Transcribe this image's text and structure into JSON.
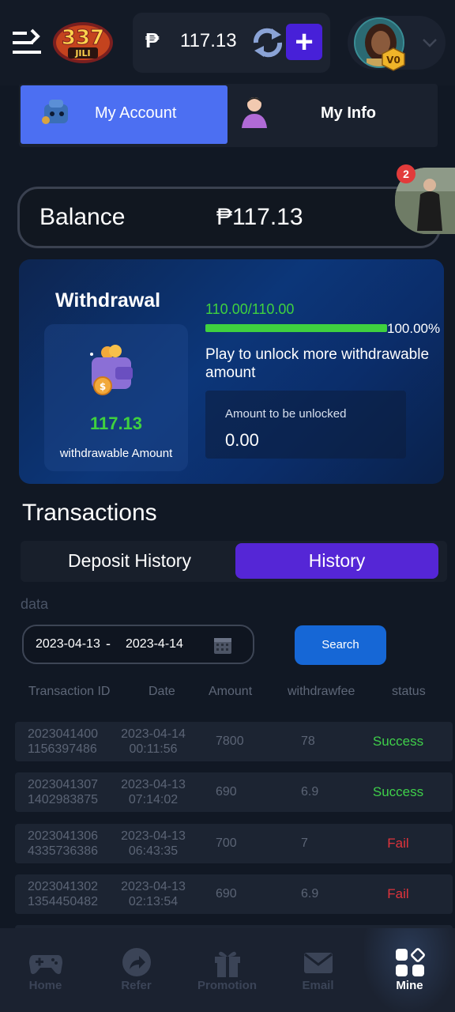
{
  "header": {
    "currency_symbol": "₱",
    "wallet_amount": "117.13",
    "plus_label": "+",
    "vip_label": "V0"
  },
  "account_tabs": {
    "my_account": "My Account",
    "my_info": "My Info"
  },
  "balance": {
    "label": "Balance",
    "value": "₱117.13",
    "notification_count": "2"
  },
  "withdrawal": {
    "title": "Withdrawal",
    "amount": "117.13",
    "amount_caption": "withdrawable Amount",
    "progress_text": "110.00/110.00",
    "progress_percent": "100.00%",
    "progress_fraction": 1.0,
    "unlock_message": "Play to unlock more withdrawable amount",
    "unlock_label": "Amount to be unlocked",
    "unlock_value": "0.00"
  },
  "transactions": {
    "title": "Transactions",
    "tab_deposit": "Deposit History",
    "tab_history": "History",
    "filter_label": "data",
    "date_from": "2023-04-13",
    "date_separator": "-",
    "date_to": "2023-4-14",
    "search_label": "Search",
    "columns": [
      "Transaction ID",
      "Date",
      "Amount",
      "withdrawfee",
      "status"
    ],
    "rows": [
      {
        "id1": "2023041400",
        "id2": "1156397486",
        "date1": "2023-04-14",
        "date2": "00:11:56",
        "amount": "7800",
        "fee": "78",
        "status": "Success"
      },
      {
        "id1": "2023041307",
        "id2": "1402983875",
        "date1": "2023-04-13",
        "date2": "07:14:02",
        "amount": "690",
        "fee": "6.9",
        "status": "Success"
      },
      {
        "id1": "2023041306",
        "id2": "4335736386",
        "date1": "2023-04-13",
        "date2": "06:43:35",
        "amount": "700",
        "fee": "7",
        "status": "Fail"
      },
      {
        "id1": "2023041302",
        "id2": "1354450482",
        "date1": "2023-04-13",
        "date2": "02:13:54",
        "amount": "690",
        "fee": "6.9",
        "status": "Fail"
      }
    ]
  },
  "bottom_nav": {
    "home": "Home",
    "refer": "Refer",
    "promotion": "Promotion",
    "email": "Email",
    "mine": "Mine"
  },
  "colors": {
    "background": "#111824",
    "accent_blue": "#4c6ff2",
    "accent_purple": "#5526d6",
    "success": "#3fcf4a",
    "fail": "#e0343c"
  }
}
